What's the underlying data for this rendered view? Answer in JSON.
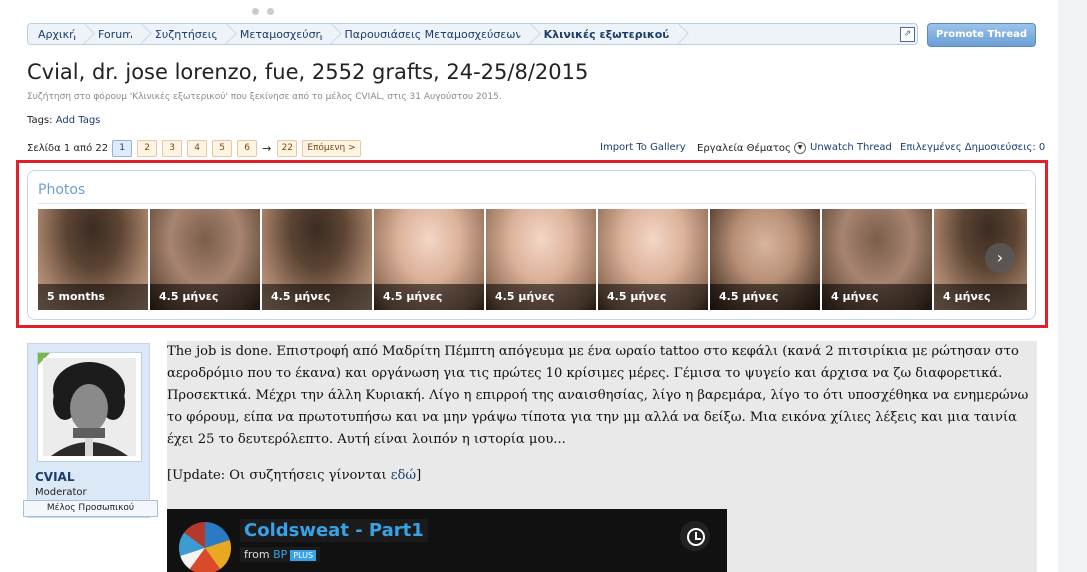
{
  "breadcrumb": [
    "Αρχική",
    "Forum",
    "Συζητήσεις",
    "Μεταμοσχεύση",
    "Παρουσιάσεις Μεταμοσχεύσεων",
    "Κλινικές εξωτερικού"
  ],
  "promote_label": "Promote Thread",
  "thread": {
    "title": "Cvial, dr. jose lorenzo, fue, 2552 grafts, 24-25/8/2015",
    "description": "Συζήτηση στο φόρουμ 'Κλινικές εξωτερικού' που ξεκίνησε από το μέλος CVIAL, στις 31 Αυγούστου 2015.",
    "tags_label": "Tags:",
    "add_tags": "Add Tags"
  },
  "pagination": {
    "label": "Σελίδα 1 από 22",
    "pages": [
      "1",
      "2",
      "3",
      "4",
      "5",
      "6"
    ],
    "arrow": "→",
    "last": "22",
    "next": "Επόμενη >"
  },
  "tools": {
    "import_gallery": "Import To Gallery",
    "thread_tools": "Εργαλεία Θέματος",
    "unwatch": "Unwatch Thread",
    "selected_label": "Επιλεγμένες Δημοσιεύσεις:",
    "selected_count": "0"
  },
  "photos": {
    "title": "Photos",
    "items": [
      {
        "caption": "5 months",
        "style": "dark"
      },
      {
        "caption": "4.5 μήνες",
        "style": "mid"
      },
      {
        "caption": "4.5 μήνες",
        "style": "dark"
      },
      {
        "caption": "4.5 μήνες",
        "style": "light"
      },
      {
        "caption": "4.5 μήνες",
        "style": "light"
      },
      {
        "caption": "4.5 μήνες",
        "style": "light"
      },
      {
        "caption": "4.5 μήνες",
        "style": "sparse"
      },
      {
        "caption": "4 μήνες",
        "style": "mid"
      },
      {
        "caption": "4 μήνες",
        "style": "dark"
      }
    ],
    "next_arrow": "›"
  },
  "post": {
    "user_name": "CVIAL",
    "user_title": "Moderator",
    "user_banner": "Μέλος Προσωπικού",
    "paragraph1": "The job is done. Επιστροφή από Μαδρίτη Πέμπτη απόγευμα με ένα ωραίο tattoo στο κεφάλι (κανά 2 πιτσιρίκια με ρώτησαν στο αεροδρόμιο που το έκανα) και οργάνωση για τις πρώτες 10 κρίσιμες μέρες. Γέμισα το ψυγείο και άρχισα να ζω διαφορετικά. Προσεκτικά. Μέχρι την άλλη Κυριακή. Λίγο η επιρροή της αναισθησίας, λίγο η βαρεμάρα, λίγο το ότι υποσχέθηκα να ενημερώνω το φόρουμ, είπα να πρωτοτυπήσω και να μην γράψω τίποτα για την μμ αλλά να δείξω. Μια εικόνα χίλιες λέξεις και μια ταινία έχει 25 το δευτερόλεπτο. Αυτή είναι λοιπόν η ιστορία μου...",
    "update_prefix": "[Update: Οι συζητήσεις γίνονται ",
    "update_link": "εδώ",
    "update_suffix": "]"
  },
  "video": {
    "title": "Coldsweat - Part1",
    "from": "from",
    "channel": "BP",
    "badge": "PLUS"
  }
}
